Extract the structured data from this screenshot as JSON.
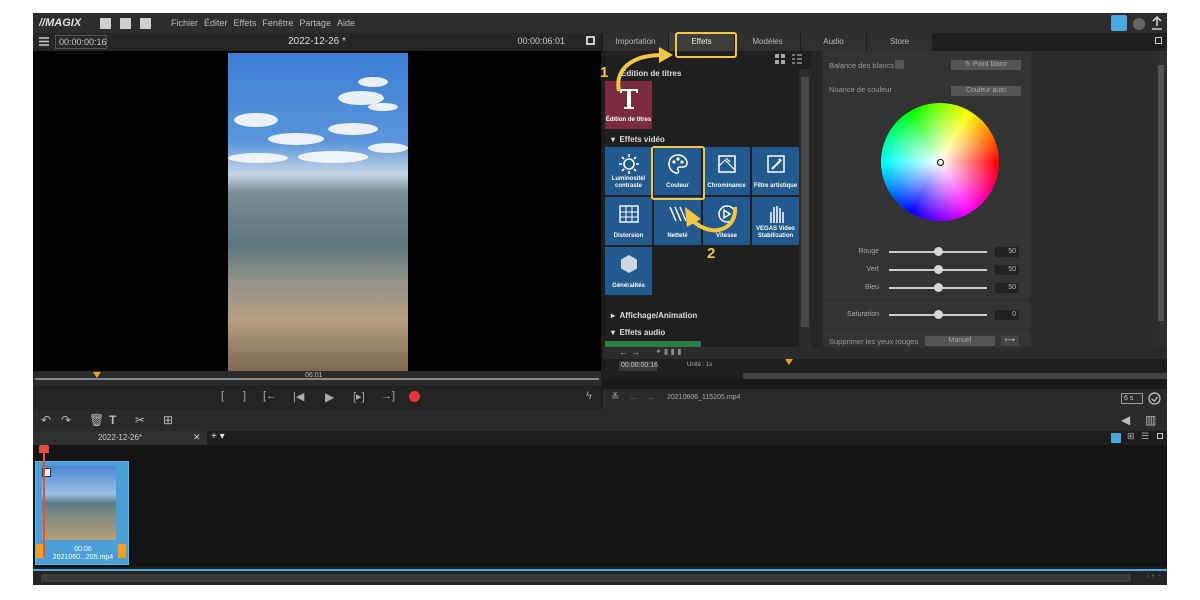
{
  "app": {
    "logo": "//MAGIX",
    "menu": [
      "Fichier",
      "Éditer",
      "Effets",
      "Fenêtre",
      "Partage",
      "Aide"
    ]
  },
  "preview": {
    "timecode_left": "00:00:00:16",
    "title": "2022-12-26 *",
    "timecode_right": "00:00:06:01",
    "scrub_time": "06:01"
  },
  "tabs": [
    "Importation",
    "Effets",
    "Modèles",
    "Audio",
    "Store"
  ],
  "active_tab": "Effets",
  "effects": {
    "section_titles": "Édition de titres",
    "tile_titles": "Édition de titres",
    "section_video": "Effets vidéo",
    "tiles": [
      "Luminosité/ contraste",
      "Couleur",
      "Chrominance",
      "Filtre artistique",
      "Distorsion",
      "Netteté",
      "Vitesse",
      "VEGAS Video Stabilization",
      "Généralités"
    ],
    "section_anim": "Affichage/Animation",
    "section_audio": "Effets audio"
  },
  "inspector": {
    "white_balance": "Balance des blancs",
    "white_point_btn": "Point blanc",
    "hue_label": "Nuance de couleur",
    "auto_color_btn": "Couleur auto",
    "sliders": [
      {
        "label": "Rouge",
        "value": "50"
      },
      {
        "label": "Vert",
        "value": "50"
      },
      {
        "label": "Bleu",
        "value": "50"
      }
    ],
    "saturation": {
      "label": "Saturation",
      "value": "0"
    },
    "red_eye": "Supprimer les yeux rouges",
    "red_eye_btn": "Manuel"
  },
  "fx_timeline": {
    "timecode": "00:00:00:16",
    "unit_label": "Unité : 1s"
  },
  "file_row": {
    "file_name": "20210606_115205.mp4",
    "zoom": "6 s"
  },
  "timeline": {
    "project_tab": "2022-12-26*",
    "clip_duration": "00:06",
    "clip_name": "2021060...205.mp4"
  },
  "annotations": [
    "1",
    "2"
  ],
  "colors": {
    "accent_annotation": "#f2c744",
    "tile_blue": "#22598f",
    "tile_titles": "#7c2a40",
    "record_red": "#e53535",
    "marker_orange": "#f0a020"
  }
}
